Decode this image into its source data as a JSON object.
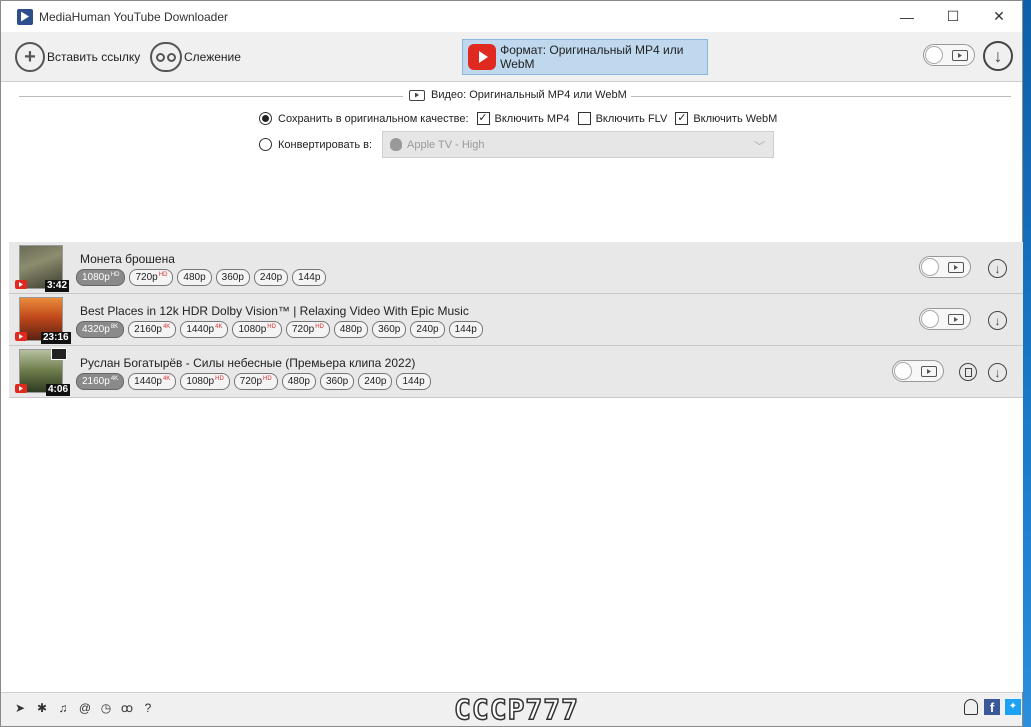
{
  "window": {
    "title": "MediaHuman YouTube Downloader",
    "controls": {
      "minimize": "—",
      "maximize": "☐",
      "close": "✕"
    }
  },
  "toolbar": {
    "paste_label": "Вставить ссылку",
    "tracking_label": "Слежение",
    "format_label": "Формат: Оригинальный MP4 или WebM"
  },
  "settings": {
    "section_title": "Видео: Оригинальный MP4 или WebM",
    "save_original_label": "Сохранить в оригинальном качестве:",
    "save_original_selected": true,
    "include_mp4_label": "Включить MP4",
    "include_mp4_checked": true,
    "include_flv_label": "Включить FLV",
    "include_flv_checked": false,
    "include_webm_label": "Включить WebM",
    "include_webm_checked": true,
    "convert_label": "Конвертировать в:",
    "convert_selected": false,
    "convert_value": "Apple TV - High"
  },
  "items": [
    {
      "title": "Монета брошена",
      "duration": "3:42",
      "qualities": [
        {
          "label": "1080p",
          "badge": "HD",
          "selected": true
        },
        {
          "label": "720p",
          "badge": "HD",
          "selected": false
        },
        {
          "label": "480p",
          "badge": "",
          "selected": false
        },
        {
          "label": "360p",
          "badge": "",
          "selected": false
        },
        {
          "label": "240p",
          "badge": "",
          "selected": false
        },
        {
          "label": "144p",
          "badge": "",
          "selected": false
        }
      ]
    },
    {
      "title": "Best Places in 12k HDR Dolby Vision™ | Relaxing Video With Epic Music",
      "duration": "23:16",
      "qualities": [
        {
          "label": "4320p",
          "badge": "8K",
          "selected": true
        },
        {
          "label": "2160p",
          "badge": "4K",
          "selected": false
        },
        {
          "label": "1440p",
          "badge": "4K",
          "selected": false
        },
        {
          "label": "1080p",
          "badge": "HD",
          "selected": false
        },
        {
          "label": "720p",
          "badge": "HD",
          "selected": false
        },
        {
          "label": "480p",
          "badge": "",
          "selected": false
        },
        {
          "label": "360p",
          "badge": "",
          "selected": false
        },
        {
          "label": "240p",
          "badge": "",
          "selected": false
        },
        {
          "label": "144p",
          "badge": "",
          "selected": false
        }
      ]
    },
    {
      "title": "Руслан Богатырёв - Силы небесные (Премьера клипа 2022)",
      "duration": "4:06",
      "qualities": [
        {
          "label": "2160p",
          "badge": "4K",
          "selected": true
        },
        {
          "label": "1440p",
          "badge": "4K",
          "selected": false
        },
        {
          "label": "1080p",
          "badge": "HD",
          "selected": false
        },
        {
          "label": "720p",
          "badge": "HD",
          "selected": false
        },
        {
          "label": "480p",
          "badge": "",
          "selected": false
        },
        {
          "label": "360p",
          "badge": "",
          "selected": false
        },
        {
          "label": "240p",
          "badge": "",
          "selected": false
        },
        {
          "label": "144p",
          "badge": "",
          "selected": false
        }
      ]
    }
  ],
  "statusbar": {
    "icons": [
      "telegram-icon",
      "gear-icon",
      "music-note-icon",
      "snail-icon",
      "clock-icon",
      "binoculars-icon",
      "help-icon"
    ],
    "watermark": "СССР777"
  },
  "colors": {
    "format_button_bg": "#bfd8ee",
    "youtube_red": "#e02a20",
    "selected_chip": "#8a8a8a"
  }
}
